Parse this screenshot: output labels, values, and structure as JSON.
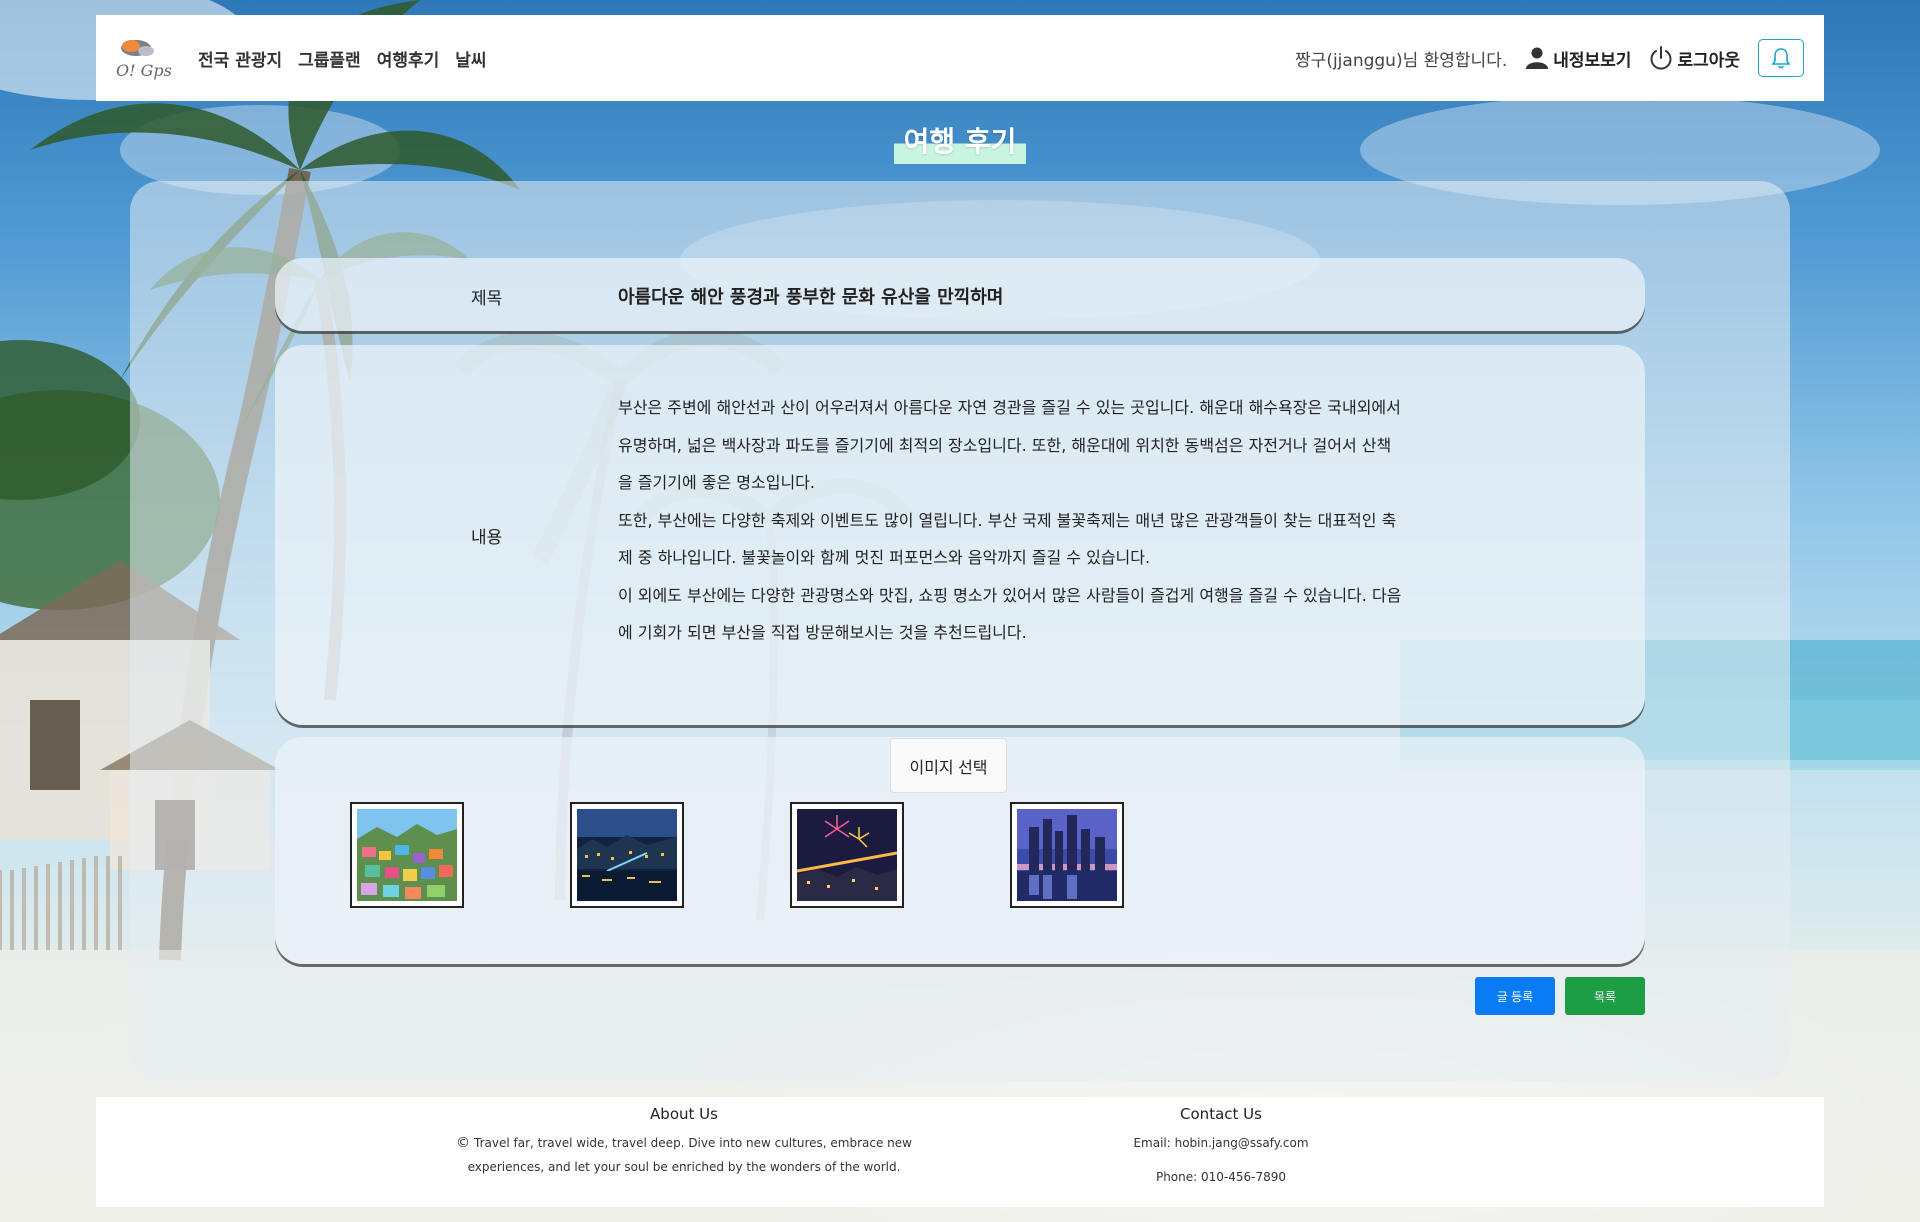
{
  "header": {
    "logo_text": "O! Gps",
    "nav": [
      "전국 관광지",
      "그룹플랜",
      "여행후기",
      "날씨"
    ],
    "welcome": "짱구(jjanggu)님 환영합니다.",
    "my_info": "내정보보기",
    "logout": "로그아웃",
    "icons": {
      "profile": "person-icon",
      "logout": "power-icon",
      "notify": "bell-icon"
    },
    "accent_color": "#19a7c9"
  },
  "page": {
    "title": "여행 후기"
  },
  "post": {
    "title_label": "제목",
    "title": "아름다운 해안 풍경과 풍부한 문화 유산을 만끽하며",
    "content_label": "내용",
    "content_lines": [
      "부산은 주변에 해안선과 산이 어우러져서 아름다운 자연 경관을 즐길 수 있는 곳입니다. 해운대 해수욕장은 국내외에서",
      "유명하며, 넓은 백사장과 파도를 즐기기에 최적의 장소입니다. 또한, 해운대에 위치한 동백섬은 자전거나 걸어서 산책",
      "을 즐기기에 좋은 명소입니다.",
      "또한, 부산에는 다양한 축제와 이벤트도 많이 열립니다. 부산 국제 불꽃축제는 매년 많은 관광객들이 찾는 대표적인 축",
      "제 중 하나입니다. 불꽃놀이와 함께 멋진 퍼포먼스와 음악까지 즐길 수 있습니다.",
      "이 외에도 부산에는 다양한 관광명소와 맛집, 쇼핑 명소가 있어서 많은 사람들이 즐겁게 여행을 즐길 수 있습니다. 다음",
      "에 기회가 되면 부산을 직접 방문해보시는 것을 추천드립니다."
    ],
    "image_select_label": "이미지 선택",
    "images": [
      "colorful-village-thumbnail",
      "harbor-night-thumbnail",
      "fireworks-bridge-thumbnail",
      "skyline-dusk-thumbnail"
    ]
  },
  "actions": {
    "register": "글 등록",
    "list": "목록",
    "register_color": "#0a7cf3",
    "list_color": "#1e9e44"
  },
  "footer": {
    "about_title": "About Us",
    "copyright_symbol": "©",
    "about_text": "Travel far, travel wide, travel deep. Dive into new cultures, embrace new experiences, and let your soul be enriched by the wonders of the world.",
    "contact_title": "Contact Us",
    "email": "Email: hobin.jang@ssafy.com",
    "phone": "Phone: 010-456-7890"
  }
}
